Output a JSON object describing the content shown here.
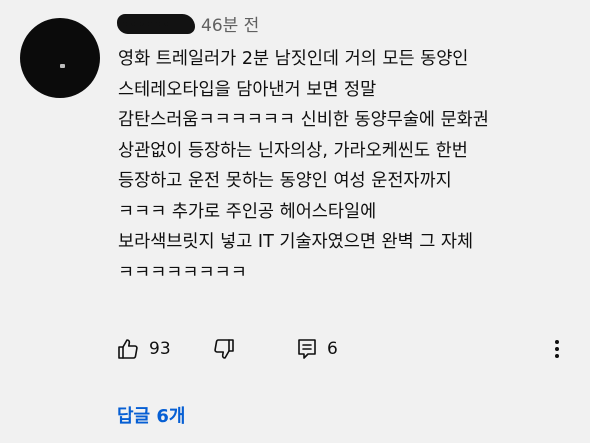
{
  "comment": {
    "author": "••••••",
    "timestamp": "46분 전",
    "lines": [
      "영화 트레일러가 2분 남짓인데 거의 모든 동양인",
      "스테레오타입을 담아낸거 보면 정말",
      "감탄스러움ㅋㅋㅋㅋㅋㅋ 신비한 동양무술에 문화권",
      "상관없이 등장하는 닌자의상, 가라오케씬도 한번",
      "등장하고 운전 못하는 동양인 여성 운전자까지",
      "ㅋㅋㅋ 추가로  주인공 헤어스타일에",
      "보라색브릿지 넣고 IT 기술자였으면 완벽 그 자체",
      "ㅋㅋㅋㅋㅋㅋㅋㅋ"
    ]
  },
  "actions": {
    "like_count": "93",
    "reply_count": "6",
    "icons": {
      "like": "thumbs-up-icon",
      "dislike": "thumbs-down-icon",
      "reply": "reply-icon",
      "more": "more-vertical-icon"
    }
  },
  "replies": {
    "label": "답글 6개"
  },
  "colors": {
    "background": "#f1f1f1",
    "text": "#0f0f0f",
    "secondary_text": "#606060",
    "link": "#065fd4"
  }
}
